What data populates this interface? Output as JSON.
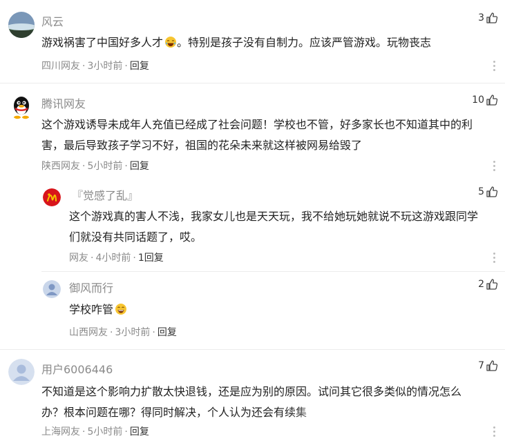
{
  "comments": [
    {
      "user": "风云",
      "likes": "3",
      "text": "游戏祸害了中国好多人才",
      "text_tail": "。特别是孩子没有自制力。应该严管游戏。玩物丧志",
      "location": "四川网友",
      "time": "3小时前",
      "reply": "回复"
    },
    {
      "user": "腾讯网友",
      "likes": "10",
      "text_line1": "这个游戏诱导未成年人充值已经成了社会问题！学校也不管，好多家长也不知道其中的利",
      "text_line2": "害，最后导致孩子学习不好，祖国的花朵未来就这样被网易给毁了",
      "location": "陕西网友",
      "time": "5小时前",
      "reply": "回复"
    },
    {
      "user": "『觉感了乱』",
      "likes": "5",
      "text_line1": "这个游戏真的害人不浅，我家女儿也是天天玩，我不给她玩她就说不玩这游戏跟同学",
      "text_line2": "们就没有共同话题了，哎。",
      "location": "网友",
      "time": "4小时前",
      "reply": "1回复"
    },
    {
      "user": "御风而行",
      "likes": "2",
      "text": "学校咋管",
      "location": "山西网友",
      "time": "3小时前",
      "reply": "回复"
    },
    {
      "user": "用户6006446",
      "likes": "7",
      "text_line1": "不知道是这个影响力扩散太快退钱，还是应为别的原因。试问其它很多类似的情况怎么",
      "text_line2": "办？根本问题在哪？得同时解决，个人认为还会有续集",
      "location": "上海网友",
      "time": "5小时前",
      "reply": "回复"
    }
  ],
  "meta_separator": "·",
  "colors": {
    "name": "#8a8a8a",
    "text": "#222222",
    "divider": "#ececec"
  }
}
